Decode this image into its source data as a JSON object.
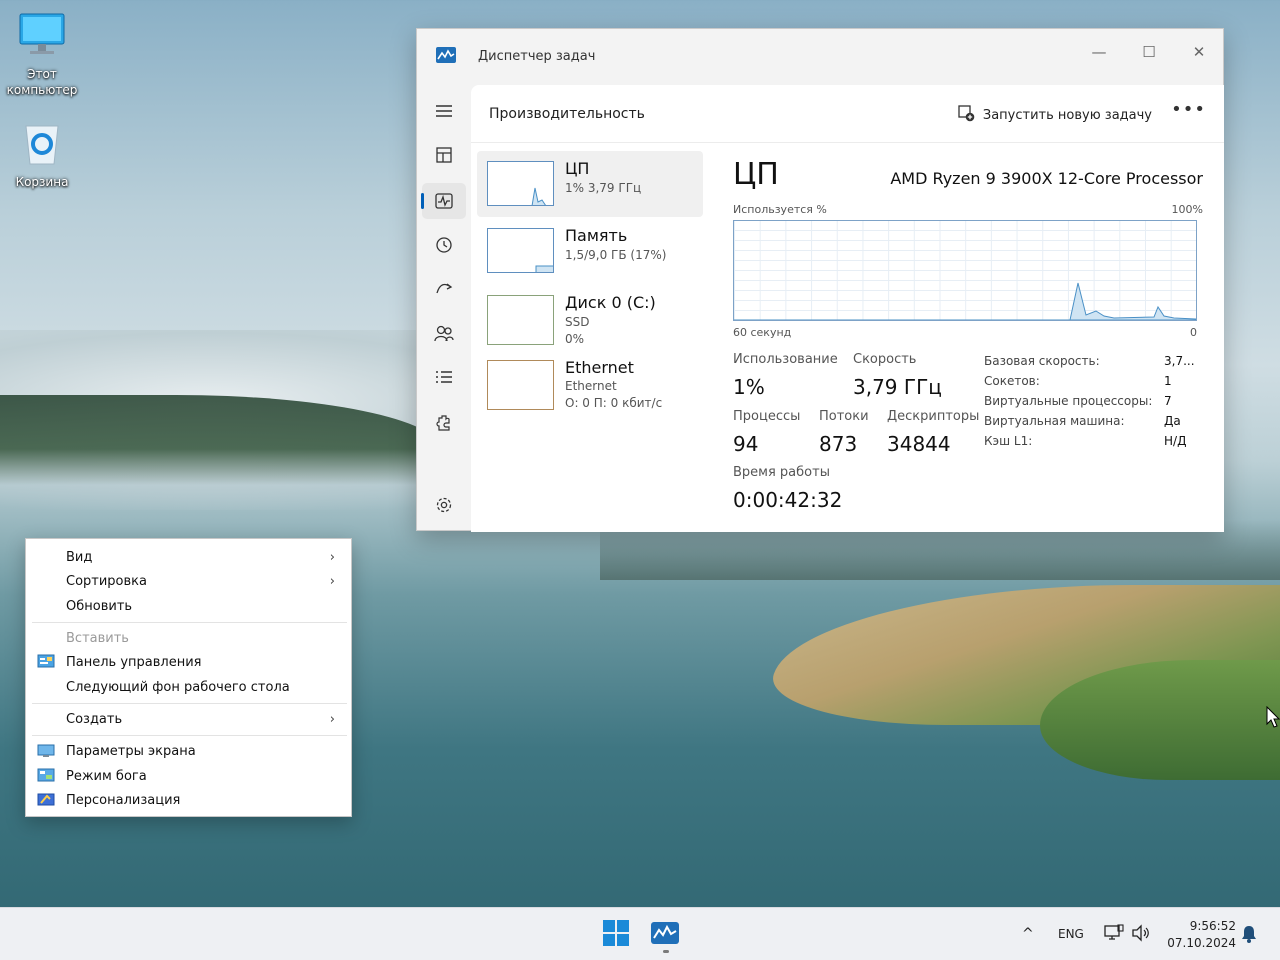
{
  "desktop": {
    "icons": [
      {
        "name": "this-pc-icon",
        "label_line1": "Этот",
        "label_line2": "компьютер"
      },
      {
        "name": "recycle-bin-icon",
        "label_line1": "Корзина"
      }
    ]
  },
  "taskmgr": {
    "title": "Диспетчер задач",
    "page_title": "Производительность",
    "new_task_label": "Запустить новую задачу",
    "more_label": "•••",
    "window_controls": {
      "minimize": "—",
      "maximize": "☐",
      "close": "✕"
    },
    "sidebar_icons": [
      "menu-icon",
      "processes-icon",
      "performance-icon",
      "app-history-icon",
      "startup-apps-icon",
      "users-icon",
      "details-icon",
      "services-icon",
      "settings-icon"
    ],
    "perf_items": [
      {
        "name": "ЦП",
        "sub1": "1%  3,79 ГГц",
        "sub2": ""
      },
      {
        "name": "Память",
        "sub1": "1,5/9,0 ГБ (17%)",
        "sub2": ""
      },
      {
        "name": "Диск 0 (C:)",
        "sub1": "SSD",
        "sub2": "0%"
      },
      {
        "name": "Ethernet",
        "sub1": "Ethernet",
        "sub2": "О: 0 П: 0 кбит/с"
      }
    ],
    "detail": {
      "title": "ЦП",
      "model": "AMD Ryzen 9 3900X 12-Core Processor",
      "graph_label_left": "Используется %",
      "graph_label_right": "100%",
      "axis_left": "60 секунд",
      "axis_right": "0",
      "usage_label": "Использование",
      "usage_value": "1%",
      "speed_label": "Скорость",
      "speed_value": "3,79 ГГц",
      "processes_label": "Процессы",
      "processes_value": "94",
      "threads_label": "Потоки",
      "threads_value": "873",
      "handles_label": "Дескрипторы",
      "handles_value": "34844",
      "uptime_label": "Время работы",
      "uptime_value": "0:00:42:32",
      "specs": [
        {
          "k": "Базовая скорость:",
          "v": "3,7..."
        },
        {
          "k": "Сокетов:",
          "v": "1"
        },
        {
          "k": "Виртуальные процессоры:",
          "v": "7"
        },
        {
          "k": "Виртуальная машина:",
          "v": "Да"
        },
        {
          "k": "Кэш L1:",
          "v": "Н/Д"
        }
      ]
    }
  },
  "context_menu": {
    "items": [
      {
        "label": "Вид",
        "submenu": true
      },
      {
        "label": "Сортировка",
        "submenu": true
      },
      {
        "label": "Обновить"
      },
      {
        "label": "Вставить",
        "disabled": true
      },
      {
        "label": "Панель управления",
        "icon": "control-panel-icon"
      },
      {
        "label": "Следующий фон рабочего стола"
      },
      {
        "label": "Создать",
        "submenu": true
      },
      {
        "label": "Параметры экрана",
        "icon": "display-settings-icon"
      },
      {
        "label": "Режим бога",
        "icon": "god-mode-icon"
      },
      {
        "label": "Персонализация",
        "icon": "personalization-icon"
      }
    ],
    "chevron": "›"
  },
  "taskbar": {
    "tray_lang": "ENG",
    "chevron_up": "^",
    "time": "9:56:52",
    "date": "07.10.2024"
  },
  "colors": {
    "accent": "#005fb8",
    "graph_line": "#4a90c6",
    "graph_fill": "#cfe4f3"
  }
}
